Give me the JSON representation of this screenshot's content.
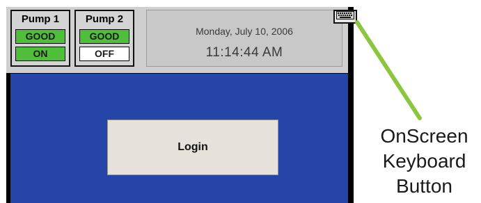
{
  "pumps": [
    {
      "name": "Pump 1",
      "health": "GOOD",
      "state": "ON"
    },
    {
      "name": "Pump 2",
      "health": "GOOD",
      "state": "OFF"
    }
  ],
  "datetime": {
    "date": "Monday, July 10, 2006",
    "time": "11:14:44 AM"
  },
  "keyboard_button": {
    "icon": "keyboard-icon"
  },
  "login": {
    "label": "Login"
  },
  "callout": {
    "line1": "OnScreen",
    "line2": "Keyboard",
    "line3": "Button",
    "color": "#8cc63f"
  },
  "colors": {
    "status_green": "#4fbe3a",
    "background_blue": "#2545a9",
    "header_gray": "#cfcfcf"
  }
}
